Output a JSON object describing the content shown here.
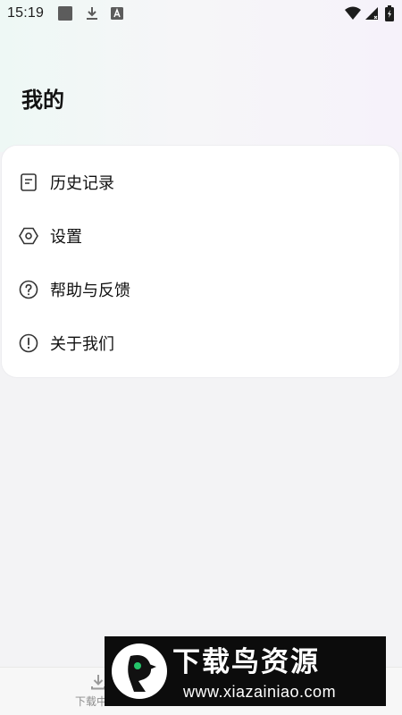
{
  "status_bar": {
    "time": "15:19",
    "left_icons": [
      "square-app-icon",
      "download-icon",
      "font-app-icon"
    ],
    "right_icons": [
      "wifi-icon",
      "signal-icon",
      "battery-icon"
    ]
  },
  "page": {
    "title": "我的"
  },
  "menu": {
    "items": [
      {
        "label": "历史记录",
        "icon": "history-icon"
      },
      {
        "label": "设置",
        "icon": "settings-icon"
      },
      {
        "label": "帮助与反馈",
        "icon": "help-icon"
      },
      {
        "label": "关于我们",
        "icon": "about-icon"
      }
    ]
  },
  "bottom_nav": {
    "items": [
      {
        "label": "下载中",
        "icon": "download-icon"
      }
    ]
  },
  "watermark": {
    "title": "下载鸟资源",
    "url": "www.xiazainiao.com"
  },
  "colors": {
    "background": "#f3f3f5",
    "card": "#ffffff",
    "text_primary": "#111111",
    "text_secondary": "#8e8e8e",
    "watermark_bg": "#0c0c0c"
  }
}
